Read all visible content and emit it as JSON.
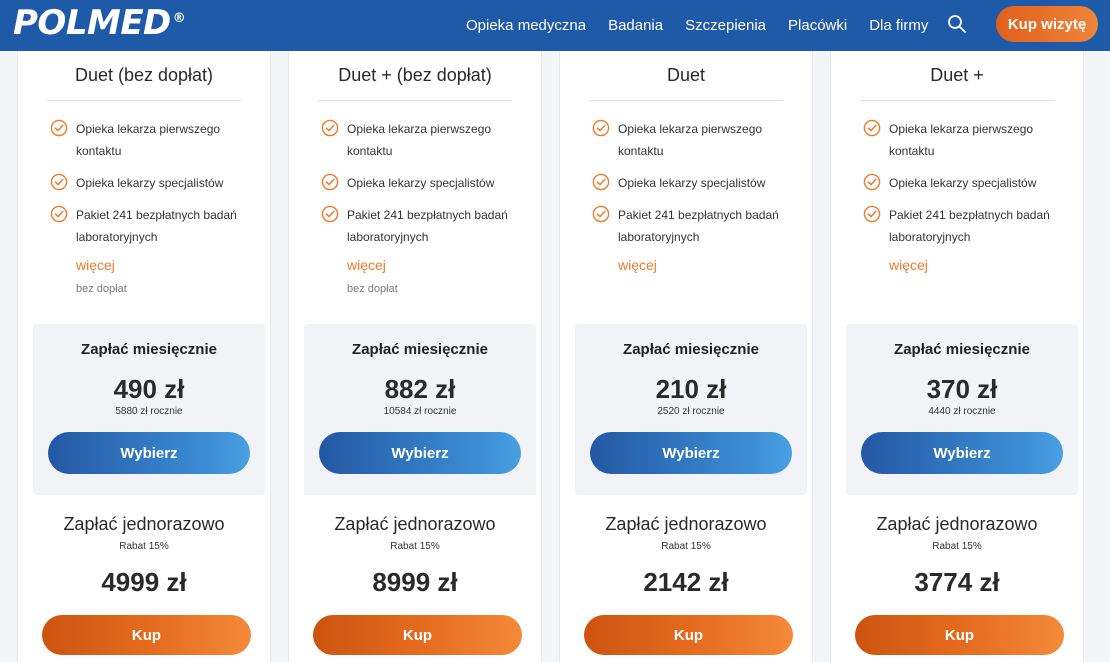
{
  "header": {
    "logo": "POLMED",
    "logo_mark": "®",
    "nav": [
      "Opieka medyczna",
      "Badania",
      "Szczepienia",
      "Placówki",
      "Dla firmy"
    ],
    "search_icon": "search-icon",
    "cta_label": "Kup wizytę",
    "colors": {
      "bar": "#1f5aa8",
      "cta": "#ec7530"
    }
  },
  "plans": [
    {
      "name": "Duet (bez dopłat)",
      "features": [
        "Opieka lekarza pierwszego kontaktu",
        "Opieka lekarzy specjalistów",
        "Pakiet 241 bezpłatnych badań laboratoryjnych"
      ],
      "more": "więcej",
      "note": "bez dopłat",
      "monthly_label": "Zapłać miesięcznie",
      "monthly_price": "490 zł",
      "yearly": "5880 zł rocznie",
      "choose": "Wybierz",
      "once_label": "Zapłać jednorazowo",
      "discount": "Rabat 15%",
      "once_price": "4999 zł",
      "buy": "Kup"
    },
    {
      "name": "Duet + (bez dopłat)",
      "features": [
        "Opieka lekarza pierwszego kontaktu",
        "Opieka lekarzy specjalistów",
        "Pakiet 241 bezpłatnych badań laboratoryjnych"
      ],
      "more": "więcej",
      "note": "bez dopłat",
      "monthly_label": "Zapłać miesięcznie",
      "monthly_price": "882 zł",
      "yearly": "10584 zł rocznie",
      "choose": "Wybierz",
      "once_label": "Zapłać jednorazowo",
      "discount": "Rabat 15%",
      "once_price": "8999 zł",
      "buy": "Kup"
    },
    {
      "name": "Duet",
      "features": [
        "Opieka lekarza pierwszego kontaktu",
        "Opieka lekarzy specjalistów",
        "Pakiet 241 bezpłatnych badań laboratoryjnych"
      ],
      "more": "więcej",
      "note": "",
      "monthly_label": "Zapłać miesięcznie",
      "monthly_price": "210 zł",
      "yearly": "2520 zł rocznie",
      "choose": "Wybierz",
      "once_label": "Zapłać jednorazowo",
      "discount": "Rabat 15%",
      "once_price": "2142 zł",
      "buy": "Kup"
    },
    {
      "name": "Duet +",
      "features": [
        "Opieka lekarza pierwszego kontaktu",
        "Opieka lekarzy specjalistów",
        "Pakiet 241 bezpłatnych badań laboratoryjnych"
      ],
      "more": "więcej",
      "note": "",
      "monthly_label": "Zapłać miesięcznie",
      "monthly_price": "370 zł",
      "yearly": "4440 zł rocznie",
      "choose": "Wybierz",
      "once_label": "Zapłać jednorazowo",
      "discount": "Rabat 15%",
      "once_price": "3774 zł",
      "buy": "Kup"
    }
  ],
  "icons": {
    "feature_check": "check-circle-icon"
  },
  "colors": {
    "accent_orange": "#ee7a2b",
    "accent_blue": "#2f73c0",
    "panel_bg": "#f1f3f7"
  }
}
